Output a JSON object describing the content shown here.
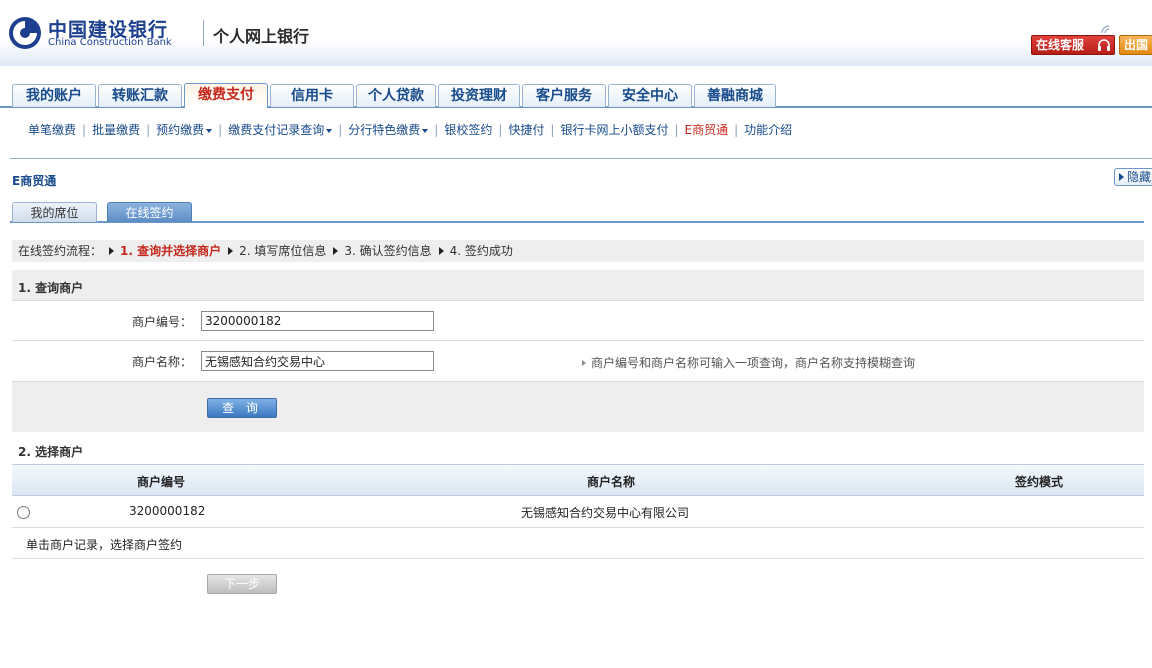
{
  "header": {
    "bank_name_cn": "中国建设银行",
    "bank_name_en": "China Construction Bank",
    "subtitle": "个人网上银行",
    "service_button": "在线客服",
    "intl_button": "出国"
  },
  "nav": {
    "tabs": [
      "我的账户",
      "转账汇款",
      "缴费支付",
      "信用卡",
      "个人贷款",
      "投资理财",
      "客户服务",
      "安全中心",
      "善融商城"
    ],
    "active": "缴费支付"
  },
  "subnav": {
    "items": [
      "单笔缴费",
      "批量缴费",
      "预约缴费",
      "缴费支付记录查询",
      "分行特色缴费",
      "银校签约",
      "快捷付",
      "银行卡网上小额支付",
      "E商贸通",
      "功能介绍"
    ],
    "highlight": "E商贸通"
  },
  "section": {
    "title": "E商贸通",
    "hide_button": "隐藏"
  },
  "subtabs": {
    "items": [
      "我的席位",
      "在线签约"
    ],
    "active": "在线签约"
  },
  "process": {
    "label": "在线签约流程：",
    "steps": [
      "1. 查询并选择商户",
      "2. 填写席位信息",
      "3. 确认签约信息",
      "4. 签约成功"
    ]
  },
  "query": {
    "heading": "1. 查询商户",
    "merchant_id_label": "商户编号：",
    "merchant_id_value": "3200000182",
    "merchant_name_label": "商户名称：",
    "merchant_name_value": "无锡感知合约交易中心",
    "hint": "商户编号和商户名称可输入一项查询，商户名称支持模糊查询",
    "query_button": "查 询"
  },
  "select": {
    "heading": "2. 选择商户",
    "columns": [
      "商户编号",
      "商户名称",
      "签约模式"
    ],
    "rows": [
      {
        "merchant_id": "3200000182",
        "merchant_name": "无锡感知合约交易中心有限公司",
        "mode": ""
      }
    ],
    "note": "单击商户记录，选择商户签约",
    "next_button": "下一步"
  },
  "colors": {
    "brand_blue": "#174a8a",
    "active_red": "#c5281c",
    "nav_border": "#6d95c5"
  }
}
